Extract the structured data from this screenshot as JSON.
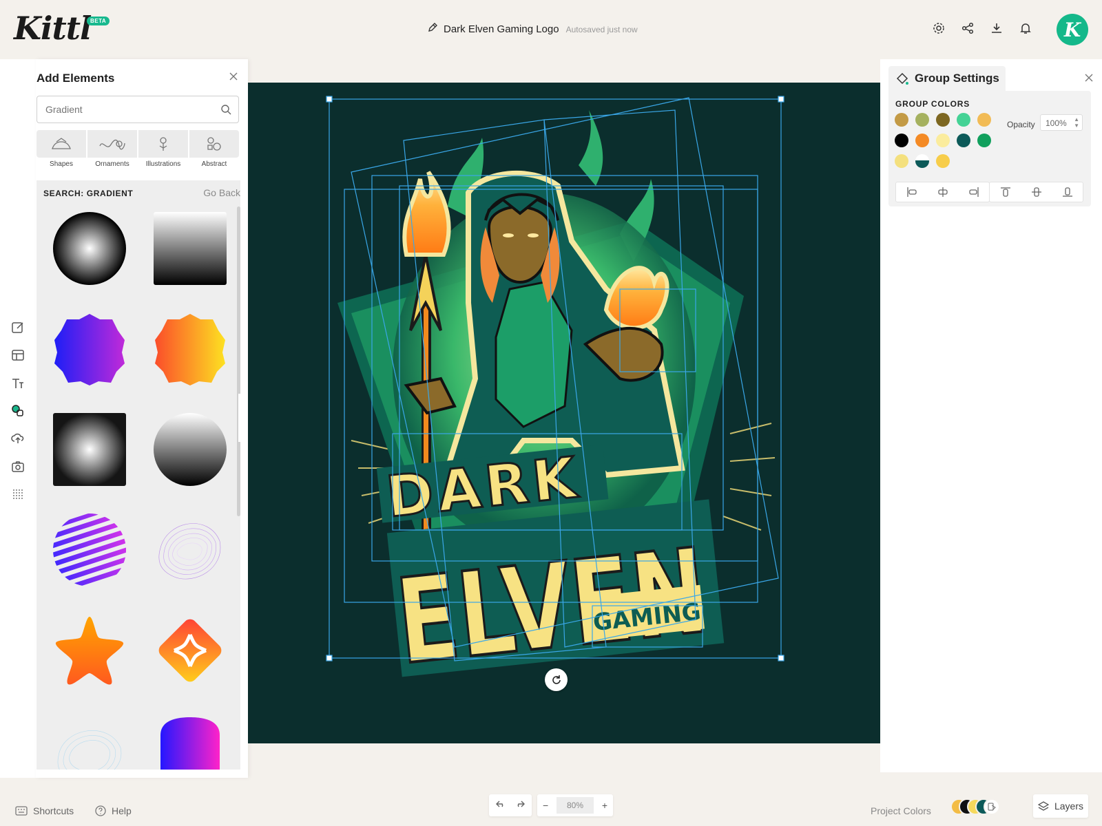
{
  "app": {
    "logo_text": "Kittl",
    "beta_badge": "BETA",
    "avatar_letter": "K",
    "brand_color": "#18b98e"
  },
  "document": {
    "title": "Dark Elven Gaming Logo",
    "save_status": "Autosaved just now"
  },
  "header_icons": [
    "gear-icon",
    "share-icon",
    "download-icon",
    "bell-icon"
  ],
  "rail_tools": [
    "edit-icon",
    "templates-icon",
    "text-icon",
    "elements-icon",
    "upload-icon",
    "camera-icon",
    "pattern-icon"
  ],
  "add_elements": {
    "title": "Add Elements",
    "search": {
      "value": "",
      "placeholder": "Gradient"
    },
    "categories": [
      {
        "label": "Shapes",
        "icon": "shapes-icon"
      },
      {
        "label": "Ornaments",
        "icon": "ornaments-icon"
      },
      {
        "label": "Illustrations",
        "icon": "illustrations-icon"
      },
      {
        "label": "Abstract",
        "icon": "abstract-icon"
      }
    ],
    "results_heading": "SEARCH: GRADIENT",
    "go_back": "Go Back",
    "results": [
      "radial-gradient-circle",
      "linear-gradient-square",
      "purple-blue-gradient-badge",
      "orange-yellow-gradient-badge",
      "radial-gradient-square",
      "gray-gradient-circle",
      "striped-gradient-sphere",
      "wireframe-gradient-blob",
      "orange-gradient-star",
      "orange-gradient-pinwheel",
      "cyan-wireframe-blob",
      "purple-gradient-shield"
    ]
  },
  "canvas": {
    "background": "#0b2e2d",
    "headline_1": "DARK",
    "headline_2": "ELVEN",
    "tagline": "GAMING"
  },
  "group_settings": {
    "title": "Group Settings",
    "colors_label": "GROUP COLORS",
    "colors": [
      "#c39a45",
      "#a5b15f",
      "#7d6721",
      "#44d295",
      "#f2bb55",
      "#000000",
      "#f48a25",
      "#fbec9d",
      "#0d5a59",
      "#11a05d",
      "#f4e07e",
      "#0d5a59",
      "#f7cd4a"
    ],
    "opacity_label": "Opacity",
    "opacity_value": "100%",
    "align_icons": [
      "align-left-icon",
      "align-center-h-icon",
      "align-right-icon",
      "align-top-icon",
      "align-middle-v-icon",
      "align-bottom-icon"
    ]
  },
  "footer": {
    "shortcuts": "Shortcuts",
    "help": "Help",
    "zoom": "80%",
    "project_colors": "Project Colors",
    "project_color_dots": [
      "#f3bc45",
      "#111111",
      "#f6d95c",
      "#0d5a59",
      "#1a6a4d"
    ],
    "layers": "Layers"
  }
}
